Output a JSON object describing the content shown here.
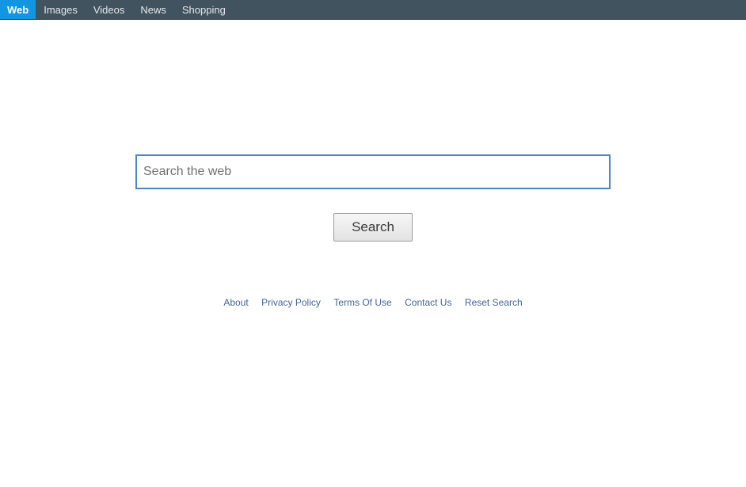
{
  "topnav": {
    "items": [
      {
        "label": "Web",
        "active": true
      },
      {
        "label": "Images",
        "active": false
      },
      {
        "label": "Videos",
        "active": false
      },
      {
        "label": "News",
        "active": false
      },
      {
        "label": "Shopping",
        "active": false
      }
    ]
  },
  "search": {
    "placeholder": "Search the web",
    "value": "",
    "button_label": "Search"
  },
  "footer": {
    "links": [
      {
        "label": "About"
      },
      {
        "label": "Privacy Policy"
      },
      {
        "label": "Terms Of Use"
      },
      {
        "label": "Contact Us"
      },
      {
        "label": "Reset Search"
      }
    ]
  }
}
